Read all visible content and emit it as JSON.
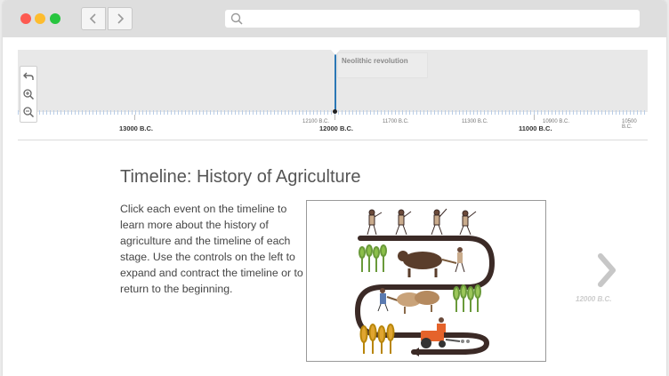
{
  "timeline": {
    "event": {
      "title": "Neolithic revolution"
    },
    "minor_ticks": [
      "12100 B.C.",
      "11700 B.C.",
      "11300 B.C.",
      "10900 B.C.",
      "10500 B.C."
    ],
    "major_ticks": [
      "13000 B.C.",
      "12000 B.C.",
      "11000 B.C."
    ],
    "controls": {
      "back_icon": "back-arrow-icon",
      "zoom_in_icon": "zoom-in-icon",
      "zoom_out_icon": "zoom-out-icon"
    },
    "accent_color": "#2b78b5"
  },
  "slide": {
    "title": "Timeline: History of Agriculture",
    "text": "Click each event on the timeline to learn more about the history of agriculture and the timeline of each stage. Use the controls on the left to expand and contract the timeline or to return to the beginning."
  },
  "nav": {
    "next_date": "12000 B.C."
  }
}
